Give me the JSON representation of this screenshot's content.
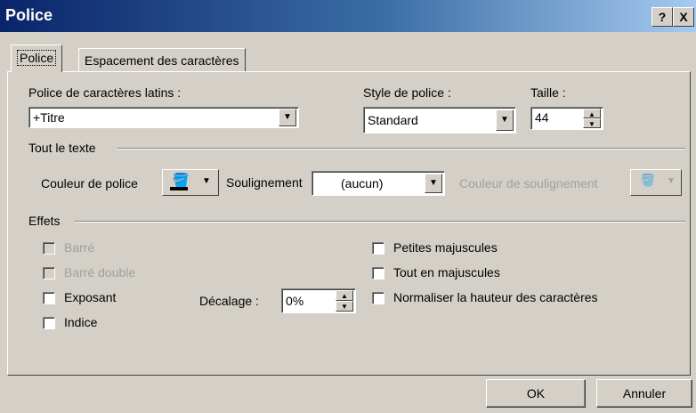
{
  "window": {
    "title": "Police",
    "help_label": "?",
    "close_label": "X"
  },
  "tabs": [
    {
      "label": "Police"
    },
    {
      "label": "Espacement des caractères"
    }
  ],
  "font": {
    "latin_label": "Police de caractères latins :",
    "latin_value": "+Titre",
    "style_label": "Style de police :",
    "style_value": "Standard",
    "size_label": "Taille :",
    "size_value": "44"
  },
  "all_text": {
    "group_label": "Tout le texte",
    "font_color_label": "Couleur de police",
    "font_color": "#000000",
    "underline_label": "Soulignement",
    "underline_value": "(aucun)",
    "underline_color_label": "Couleur de soulignement"
  },
  "effects": {
    "group_label": "Effets",
    "left": [
      {
        "label": "Barré",
        "checked": false,
        "disabled": true
      },
      {
        "label": "Barré double",
        "checked": false,
        "disabled": true
      },
      {
        "label": "Exposant",
        "checked": false,
        "disabled": false
      },
      {
        "label": "Indice",
        "checked": false,
        "disabled": false
      }
    ],
    "offset_label": "Décalage :",
    "offset_value": "0%",
    "right": [
      {
        "label": "Petites majuscules",
        "checked": false
      },
      {
        "label": "Tout en majuscules",
        "checked": false
      },
      {
        "label": "Normaliser la hauteur des caractères",
        "checked": false
      }
    ]
  },
  "buttons": {
    "ok": "OK",
    "cancel": "Annuler"
  },
  "colors": {
    "titlebar": "#0a246a",
    "dialog_bg": "#d4d0c8"
  }
}
